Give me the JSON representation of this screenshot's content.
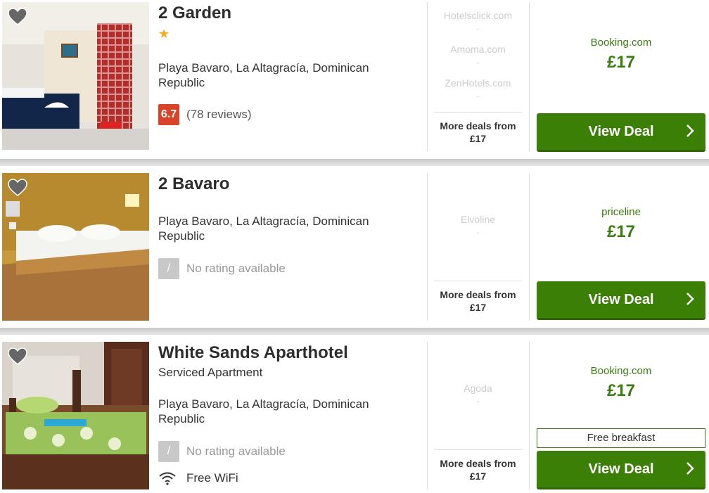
{
  "hotels": [
    {
      "name": "2 Garden",
      "subtype": "",
      "stars": "★",
      "location": "Playa Bavaro, La Altagracía, Dominican Republic",
      "rating": {
        "score": "6.7",
        "text": "(78 reviews)"
      },
      "deals": [
        {
          "name": "Hotelsclick.com",
          "price": "-"
        },
        {
          "name": "Amoma.com",
          "price": "-"
        },
        {
          "name": "ZenHotels.com",
          "price": "-"
        }
      ],
      "more_deals": "More deals from £17",
      "best": {
        "provider": "Booking.com",
        "price": "£17",
        "extra": ""
      },
      "cta": "View Deal"
    },
    {
      "name": "2 Bavaro",
      "subtype": "",
      "stars": "",
      "location": "Playa Bavaro, La Altagracía, Dominican Republic",
      "rating": {
        "score": "/",
        "text": "No rating available"
      },
      "deals": [
        {
          "name": "Elvoline",
          "price": "-"
        }
      ],
      "more_deals": "More deals from £17",
      "best": {
        "provider": "priceline",
        "price": "£17",
        "extra": ""
      },
      "cta": "View Deal"
    },
    {
      "name": "White Sands Aparthotel",
      "subtype": "Serviced Apartment",
      "stars": "",
      "location": "Playa Bavaro, La Altagracía, Dominican Republic",
      "rating": {
        "score": "/",
        "text": "No rating available"
      },
      "amenity": "Free WiFi",
      "deals": [
        {
          "name": "Agoda",
          "price": "-"
        }
      ],
      "more_deals": "More deals from £17",
      "best": {
        "provider": "Booking.com",
        "price": "£17",
        "extra": "Free breakfast"
      },
      "cta": "View Deal"
    }
  ],
  "icons": {
    "favorite": "heart-icon",
    "wifi": "wifi-icon",
    "chevron": "chevron-right-icon"
  },
  "colors": {
    "accent_green": "#3b7f06",
    "price_green": "#3a7c12",
    "rating_red": "#d8432a",
    "star": "#f6ab1b"
  }
}
